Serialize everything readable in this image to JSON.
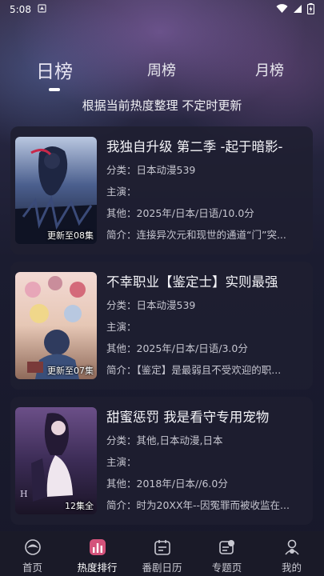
{
  "status_bar": {
    "time": "5:08"
  },
  "tabs": [
    {
      "label": "日榜",
      "active": true
    },
    {
      "label": "周榜",
      "active": false
    },
    {
      "label": "月榜",
      "active": false
    }
  ],
  "subtitle": "根据当前热度整理 不定时更新",
  "items": [
    {
      "title": "我独自升级 第二季 -起于暗影-",
      "category": "分类：日本动漫539",
      "cast": "主演：",
      "other": "其他：2025年/日本/日语/10.0分",
      "summary": "简介：连接异次元和现世的通道“门”突...",
      "badge": "更新至08集"
    },
    {
      "title": "不幸职业【鉴定士】实则最强",
      "category": "分类：日本动漫539",
      "cast": "主演：",
      "other": "其他：2025年/日本/日语/3.0分",
      "summary": "简介：【鉴定】是最弱且不受欢迎的职...",
      "badge": "更新至07集"
    },
    {
      "title": "甜蜜惩罚 我是看守专用宠物",
      "category": "分类：其他,日本动漫,日本",
      "cast": "主演：",
      "other": "其他：2018年/日本//6.0分",
      "summary": "简介：时为20XX年--因冤罪而被收监在...",
      "badge": "12集全"
    }
  ],
  "nav": [
    {
      "label": "首页",
      "icon": "home-icon",
      "active": false
    },
    {
      "label": "热度排行",
      "icon": "ranking-icon",
      "active": true
    },
    {
      "label": "番剧日历",
      "icon": "calendar-icon",
      "active": false
    },
    {
      "label": "专题页",
      "icon": "topic-icon",
      "active": false
    },
    {
      "label": "我的",
      "icon": "profile-icon",
      "active": false
    }
  ]
}
